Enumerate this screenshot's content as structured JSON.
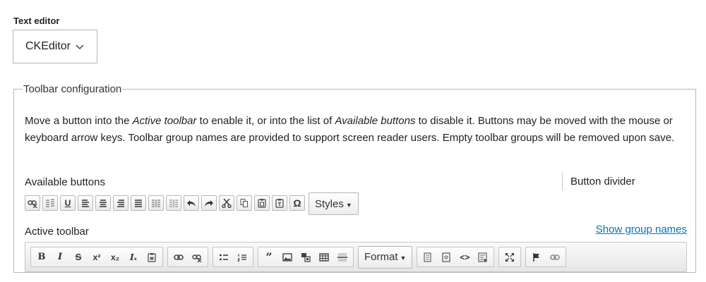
{
  "text_editor": {
    "label": "Text editor",
    "selected": "CKEditor"
  },
  "toolbar_config": {
    "legend": "Toolbar configuration",
    "description_parts": {
      "p1": "Move a button into the ",
      "em1": "Active toolbar",
      "p2": " to enable it, or into the list of ",
      "em2": "Available buttons",
      "p3": " to disable it. Buttons may be moved with the mouse or keyboard arrow keys. Toolbar group names are provided to support screen reader users. Empty toolbar groups will be removed upon save."
    },
    "available_label": "Available buttons",
    "button_divider_label": "Button divider",
    "available_buttons": [
      {
        "name": "unlink-icon"
      },
      {
        "name": "language-icon"
      },
      {
        "name": "underline-icon",
        "glyph": "U"
      },
      {
        "name": "align-left-icon"
      },
      {
        "name": "align-center-icon"
      },
      {
        "name": "align-right-icon"
      },
      {
        "name": "align-justify-icon"
      },
      {
        "name": "indent-icon"
      },
      {
        "name": "outdent-icon"
      },
      {
        "name": "undo-icon"
      },
      {
        "name": "redo-icon"
      },
      {
        "name": "cut-icon"
      },
      {
        "name": "copy-icon"
      },
      {
        "name": "paste-icon"
      },
      {
        "name": "paste-text-icon"
      },
      {
        "name": "special-char-icon",
        "glyph": "Ω"
      }
    ],
    "styles_label": "Styles",
    "active_label": "Active toolbar",
    "show_group_names": "Show group names",
    "active_groups": {
      "formatting": {
        "bold": "B",
        "italic": "I",
        "strike": "S",
        "superscript": "x²",
        "subscript": "x₂",
        "remove_format": "Iₓ"
      },
      "format_label": "Format"
    }
  },
  "colors": {
    "link": "#0074bd",
    "border": "#b8b8b8",
    "text": "#222222"
  }
}
